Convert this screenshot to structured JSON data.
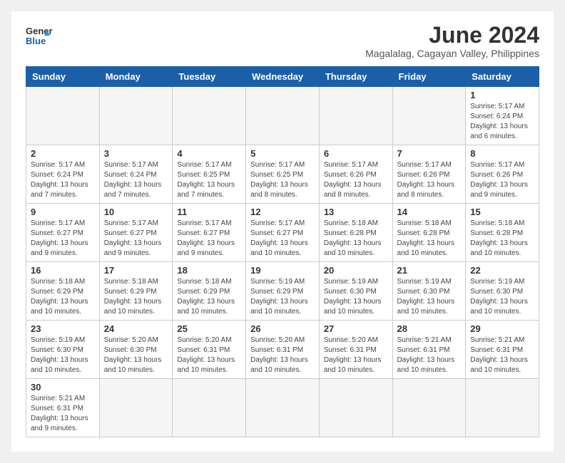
{
  "logo": {
    "part1": "General",
    "part2": "Blue"
  },
  "title": "June 2024",
  "subtitle": "Magalalag, Cagayan Valley, Philippines",
  "days_of_week": [
    "Sunday",
    "Monday",
    "Tuesday",
    "Wednesday",
    "Thursday",
    "Friday",
    "Saturday"
  ],
  "weeks": [
    [
      {
        "day": "",
        "info": ""
      },
      {
        "day": "",
        "info": ""
      },
      {
        "day": "",
        "info": ""
      },
      {
        "day": "",
        "info": ""
      },
      {
        "day": "",
        "info": ""
      },
      {
        "day": "",
        "info": ""
      },
      {
        "day": "1",
        "info": "Sunrise: 5:17 AM\nSunset: 6:24 PM\nDaylight: 13 hours and 6 minutes."
      }
    ],
    [
      {
        "day": "2",
        "info": "Sunrise: 5:17 AM\nSunset: 6:24 PM\nDaylight: 13 hours and 7 minutes."
      },
      {
        "day": "3",
        "info": "Sunrise: 5:17 AM\nSunset: 6:24 PM\nDaylight: 13 hours and 7 minutes."
      },
      {
        "day": "4",
        "info": "Sunrise: 5:17 AM\nSunset: 6:25 PM\nDaylight: 13 hours and 7 minutes."
      },
      {
        "day": "5",
        "info": "Sunrise: 5:17 AM\nSunset: 6:25 PM\nDaylight: 13 hours and 8 minutes."
      },
      {
        "day": "6",
        "info": "Sunrise: 5:17 AM\nSunset: 6:26 PM\nDaylight: 13 hours and 8 minutes."
      },
      {
        "day": "7",
        "info": "Sunrise: 5:17 AM\nSunset: 6:26 PM\nDaylight: 13 hours and 8 minutes."
      },
      {
        "day": "8",
        "info": "Sunrise: 5:17 AM\nSunset: 6:26 PM\nDaylight: 13 hours and 9 minutes."
      }
    ],
    [
      {
        "day": "9",
        "info": "Sunrise: 5:17 AM\nSunset: 6:27 PM\nDaylight: 13 hours and 9 minutes."
      },
      {
        "day": "10",
        "info": "Sunrise: 5:17 AM\nSunset: 6:27 PM\nDaylight: 13 hours and 9 minutes."
      },
      {
        "day": "11",
        "info": "Sunrise: 5:17 AM\nSunset: 6:27 PM\nDaylight: 13 hours and 9 minutes."
      },
      {
        "day": "12",
        "info": "Sunrise: 5:17 AM\nSunset: 6:27 PM\nDaylight: 13 hours and 10 minutes."
      },
      {
        "day": "13",
        "info": "Sunrise: 5:18 AM\nSunset: 6:28 PM\nDaylight: 13 hours and 10 minutes."
      },
      {
        "day": "14",
        "info": "Sunrise: 5:18 AM\nSunset: 6:28 PM\nDaylight: 13 hours and 10 minutes."
      },
      {
        "day": "15",
        "info": "Sunrise: 5:18 AM\nSunset: 6:28 PM\nDaylight: 13 hours and 10 minutes."
      }
    ],
    [
      {
        "day": "16",
        "info": "Sunrise: 5:18 AM\nSunset: 6:29 PM\nDaylight: 13 hours and 10 minutes."
      },
      {
        "day": "17",
        "info": "Sunrise: 5:18 AM\nSunset: 6:29 PM\nDaylight: 13 hours and 10 minutes."
      },
      {
        "day": "18",
        "info": "Sunrise: 5:18 AM\nSunset: 6:29 PM\nDaylight: 13 hours and 10 minutes."
      },
      {
        "day": "19",
        "info": "Sunrise: 5:19 AM\nSunset: 6:29 PM\nDaylight: 13 hours and 10 minutes."
      },
      {
        "day": "20",
        "info": "Sunrise: 5:19 AM\nSunset: 6:30 PM\nDaylight: 13 hours and 10 minutes."
      },
      {
        "day": "21",
        "info": "Sunrise: 5:19 AM\nSunset: 6:30 PM\nDaylight: 13 hours and 10 minutes."
      },
      {
        "day": "22",
        "info": "Sunrise: 5:19 AM\nSunset: 6:30 PM\nDaylight: 13 hours and 10 minutes."
      }
    ],
    [
      {
        "day": "23",
        "info": "Sunrise: 5:19 AM\nSunset: 6:30 PM\nDaylight: 13 hours and 10 minutes."
      },
      {
        "day": "24",
        "info": "Sunrise: 5:20 AM\nSunset: 6:30 PM\nDaylight: 13 hours and 10 minutes."
      },
      {
        "day": "25",
        "info": "Sunrise: 5:20 AM\nSunset: 6:31 PM\nDaylight: 13 hours and 10 minutes."
      },
      {
        "day": "26",
        "info": "Sunrise: 5:20 AM\nSunset: 6:31 PM\nDaylight: 13 hours and 10 minutes."
      },
      {
        "day": "27",
        "info": "Sunrise: 5:20 AM\nSunset: 6:31 PM\nDaylight: 13 hours and 10 minutes."
      },
      {
        "day": "28",
        "info": "Sunrise: 5:21 AM\nSunset: 6:31 PM\nDaylight: 13 hours and 10 minutes."
      },
      {
        "day": "29",
        "info": "Sunrise: 5:21 AM\nSunset: 6:31 PM\nDaylight: 13 hours and 10 minutes."
      }
    ],
    [
      {
        "day": "30",
        "info": "Sunrise: 5:21 AM\nSunset: 6:31 PM\nDaylight: 13 hours and 9 minutes."
      },
      {
        "day": "",
        "info": ""
      },
      {
        "day": "",
        "info": ""
      },
      {
        "day": "",
        "info": ""
      },
      {
        "day": "",
        "info": ""
      },
      {
        "day": "",
        "info": ""
      },
      {
        "day": "",
        "info": ""
      }
    ]
  ]
}
